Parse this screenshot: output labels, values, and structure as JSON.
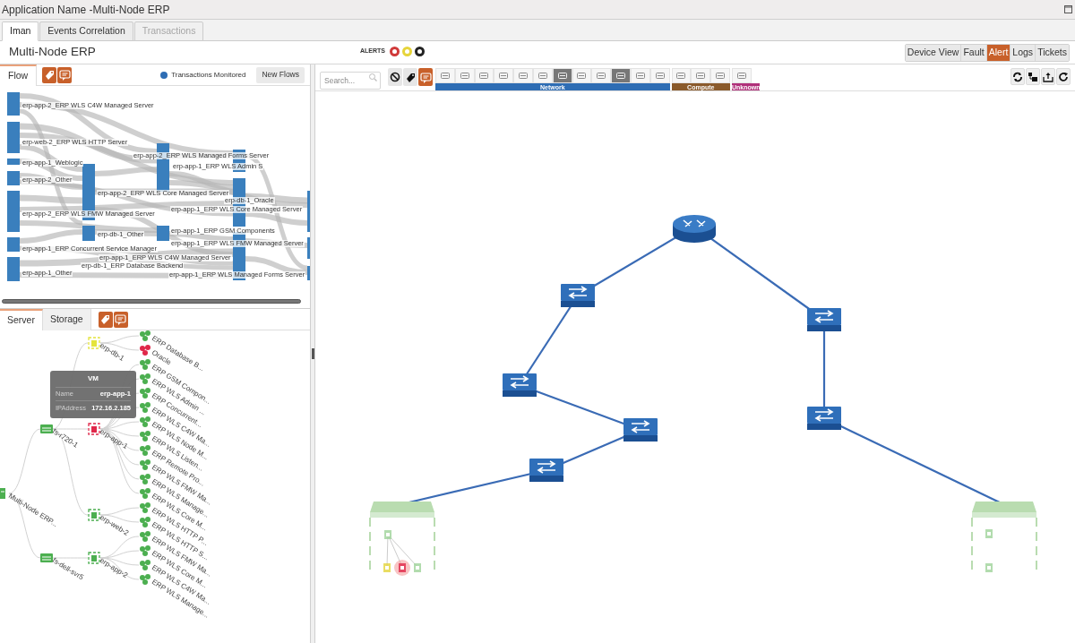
{
  "window": {
    "title": "Application Name -Multi-Node ERP"
  },
  "tabs": [
    {
      "label": "Iman",
      "selected": true,
      "disabled": false
    },
    {
      "label": "Events Correlation",
      "selected": false,
      "disabled": false
    },
    {
      "label": "Transactions",
      "selected": false,
      "disabled": true
    }
  ],
  "header": {
    "title": "Multi-Node ERP",
    "alerts_label": "ALERTS",
    "alert_dots": [
      {
        "color": "#d03a3a"
      },
      {
        "color": "#e6d43a"
      },
      {
        "color": "#222222"
      }
    ],
    "views": [
      {
        "label": "Device View",
        "selected": false
      },
      {
        "label": "Fault",
        "selected": false
      },
      {
        "label": "Alert",
        "selected": true
      },
      {
        "label": "Logs",
        "selected": false
      },
      {
        "label": "Tickets",
        "selected": false
      }
    ]
  },
  "flow_panel": {
    "tabs": [
      {
        "label": "Flow",
        "selected": true
      }
    ],
    "legend": "Transactions Monitored",
    "new_flows_button": "New Flows",
    "flow_labels": [
      "erp-app-2_ERP WLS C4W Managed Server",
      "erp-web-2_ERP WLS HTTP Server",
      "erp-app-1_Weblogic",
      "erp-app-2_Other",
      "erp-app-2_ERP WLS FMW Managed Server",
      "erp-app-1_ERP Concurrent Service Manager",
      "erp-app-1_Other",
      "erp-app-2_ERP WLS Managed Forms Server",
      "erp-app-1_ERP WLS Admin S",
      "erp-app-2_ERP WLS Core Managed Server",
      "erp-db-1_Oracle",
      "erp-app-1_ERP WLS Core Managed Server",
      "erp-db-1_Other",
      "erp-app-1_ERP GSM Components",
      "erp-app-1_ERP WLS C4W Managed Server",
      "erp-db-1_ERP Database Backend",
      "erp-app-1_ERP WLS FMW Managed Server",
      "erp-app-1_ERP WLS Managed Forms Server"
    ]
  },
  "server_panel": {
    "tabs": [
      {
        "label": "Server",
        "selected": true
      },
      {
        "label": "Storage",
        "selected": false
      }
    ],
    "tree": {
      "label": "Multi-Node ERP...",
      "kind": "app",
      "color": "#4caf50",
      "children": [
        {
          "label": "fs-r720-1",
          "kind": "host",
          "color": "#4caf50",
          "children": [
            {
              "label": "erp-db-1",
              "kind": "vm",
              "color": "#e4e43c",
              "children": [
                {
                  "label": "ERP Database B...",
                  "kind": "service",
                  "color": "#4caf50"
                },
                {
                  "label": "Oracle",
                  "kind": "service",
                  "color": "#e0284a"
                }
              ]
            },
            {
              "label": "erp-app-1",
              "kind": "vm",
              "color": "#e0284a",
              "children": [
                {
                  "label": "ERP GSM Compon...",
                  "kind": "service",
                  "color": "#4caf50"
                },
                {
                  "label": "ERP WLS Admin ...",
                  "kind": "service",
                  "color": "#4caf50"
                },
                {
                  "label": "ERP Concurrent...",
                  "kind": "service",
                  "color": "#4caf50"
                },
                {
                  "label": "ERP WLS C4W Ma...",
                  "kind": "service",
                  "color": "#4caf50"
                },
                {
                  "label": "ERP WLS Node M...",
                  "kind": "service",
                  "color": "#4caf50"
                },
                {
                  "label": "ERP WLS Listen...",
                  "kind": "service",
                  "color": "#4caf50"
                },
                {
                  "label": "ERP Remote Pro...",
                  "kind": "service",
                  "color": "#4caf50"
                },
                {
                  "label": "ERP WLS FMW Ma...",
                  "kind": "service",
                  "color": "#4caf50"
                },
                {
                  "label": "ERP WLS Manage...",
                  "kind": "service",
                  "color": "#4caf50"
                },
                {
                  "label": "ERP WLS Core M...",
                  "kind": "service",
                  "color": "#4caf50"
                }
              ]
            },
            {
              "label": "erp-web-2",
              "kind": "vm",
              "color": "#4caf50",
              "children": [
                {
                  "label": "ERP WLS HTTP P...",
                  "kind": "service",
                  "color": "#4caf50"
                },
                {
                  "label": "ERP WLS HTTP S...",
                  "kind": "service",
                  "color": "#4caf50"
                }
              ]
            }
          ]
        },
        {
          "label": "fs-dell-svr5",
          "kind": "host",
          "color": "#4caf50",
          "children": [
            {
              "label": "erp-app-2",
              "kind": "vm",
              "color": "#4caf50",
              "children": [
                {
                  "label": "ERP WLS FMW Ma...",
                  "kind": "service",
                  "color": "#4caf50"
                },
                {
                  "label": "ERP WLS Core M...",
                  "kind": "service",
                  "color": "#4caf50"
                },
                {
                  "label": "ERP WLS C4W Ma...",
                  "kind": "service",
                  "color": "#4caf50"
                },
                {
                  "label": "ERP WLS Manage...",
                  "kind": "service",
                  "color": "#4caf50"
                }
              ]
            }
          ]
        }
      ]
    },
    "tooltip": {
      "title": "VM",
      "rows": [
        {
          "key": "Name",
          "value": "erp-app-1"
        },
        {
          "key": "IPAddress",
          "value": "172.16.2.185"
        }
      ]
    }
  },
  "topology": {
    "search": {
      "placeholder": "Search..."
    },
    "categories": [
      {
        "label": "Network",
        "color": "#2e6db4",
        "items": [
          {
            "selected": false
          },
          {
            "selected": false
          },
          {
            "selected": false
          },
          {
            "selected": false
          },
          {
            "selected": false
          },
          {
            "selected": false
          },
          {
            "selected": true
          },
          {
            "selected": false
          },
          {
            "selected": false
          },
          {
            "selected": true
          },
          {
            "selected": false
          },
          {
            "selected": false
          }
        ]
      },
      {
        "label": "Compute",
        "color": "#8a5a2b",
        "items": [
          {
            "selected": false
          },
          {
            "selected": false
          },
          {
            "selected": false
          }
        ]
      },
      {
        "label": "Unknown",
        "color": "#b0307a",
        "items": [
          {
            "selected": false
          }
        ]
      }
    ]
  }
}
